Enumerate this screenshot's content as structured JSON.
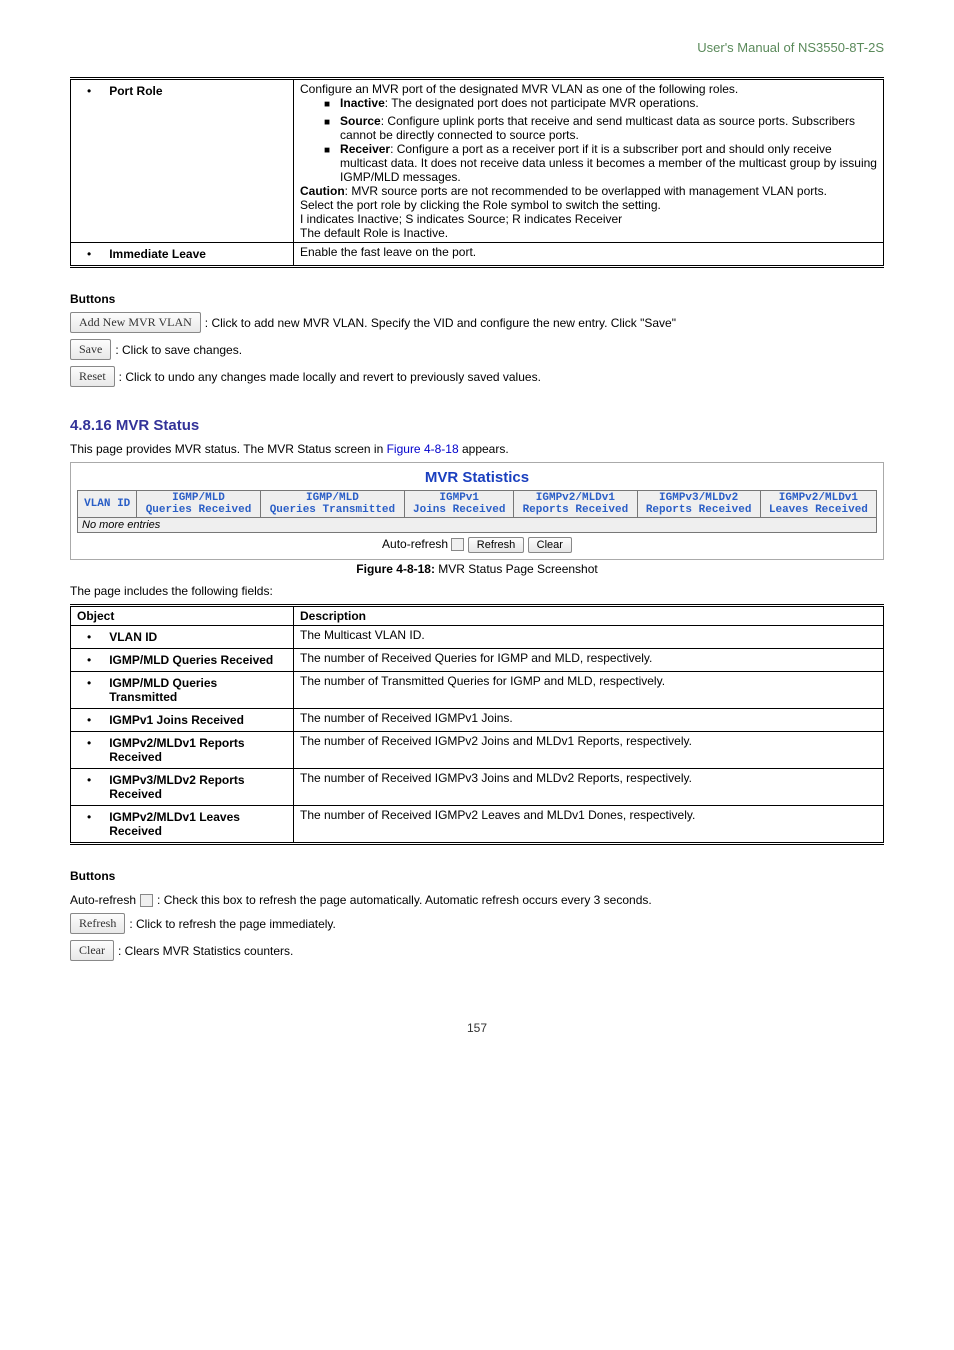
{
  "header": "User's Manual of NS3550-8T-2S",
  "topTable": {
    "rows": [
      {
        "object": "Port Role",
        "intro": "Configure an MVR port of the designated MVR VLAN as one of the following roles.",
        "items": [
          {
            "label": "Inactive",
            "text": ": The designated port does not participate MVR operations."
          },
          {
            "label": "Source",
            "text": ": Configure uplink ports that receive and send multicast data as source ports. Subscribers cannot be directly connected to source ports."
          },
          {
            "label": "Receiver",
            "text": ": Configure a port as a receiver port if it is a subscriber port and should only receive multicast data. It does not receive data unless it becomes a member of the multicast group by issuing IGMP/MLD messages."
          }
        ],
        "caution_label": "Caution",
        "caution": ": MVR source ports are not recommended to be overlapped with management VLAN ports.",
        "tail1": "Select the port role by clicking the Role symbol to switch the setting.",
        "tail2": "I indicates Inactive; S indicates Source; R indicates Receiver",
        "tail3": "The default Role is Inactive."
      },
      {
        "object": "Immediate Leave",
        "intro": "Enable the fast leave on the port."
      }
    ]
  },
  "buttonsTitle": "Buttons",
  "buttons": [
    {
      "label": "Add New MVR VLAN",
      "desc": ": Click to add new MVR VLAN. Specify the VID and configure the new entry. Click \"Save\""
    },
    {
      "label": "Save",
      "desc": ": Click to save changes."
    },
    {
      "label": "Reset",
      "desc": ": Click to undo any changes made locally and revert to previously saved values."
    }
  ],
  "section2": {
    "num": "4.8.16",
    "title": "MVR Status",
    "intro_a": "This page provides MVR status. The MVR Status screen in ",
    "intro_link": "Figure 4-8-18",
    "intro_b": " appears.",
    "screenshot": {
      "title": "MVR Statistics",
      "headers": [
        {
          "l1": "",
          "l2": "VLAN ID"
        },
        {
          "l1": "IGMP/MLD",
          "l2": "Queries Received"
        },
        {
          "l1": "IGMP/MLD",
          "l2": "Queries Transmitted"
        },
        {
          "l1": "IGMPv1",
          "l2": "Joins Received"
        },
        {
          "l1": "IGMPv2/MLDv1",
          "l2": "Reports Received"
        },
        {
          "l1": "IGMPv3/MLDv2",
          "l2": "Reports Received"
        },
        {
          "l1": "IGMPv2/MLDv1",
          "l2": "Leaves Received"
        }
      ],
      "no_entries": "No more entries",
      "auto_refresh": "Auto-refresh",
      "refresh": "Refresh",
      "clear": "Clear"
    },
    "caption_a": "Figure 4-8-18:",
    "caption_b": " MVR Status Page Screenshot",
    "fields_intro": "The page includes the following fields:",
    "fields_header": {
      "object": "Object",
      "desc": "Description"
    },
    "fields": [
      {
        "object": "VLAN ID",
        "desc": "The Multicast VLAN ID."
      },
      {
        "object": "IGMP/MLD Queries Received",
        "desc": "The number of Received Queries for IGMP and MLD, respectively."
      },
      {
        "object": "IGMP/MLD Queries Transmitted",
        "desc": "The number of Transmitted Queries for IGMP and MLD, respectively."
      },
      {
        "object": "IGMPv1 Joins Received",
        "desc": "The number of Received IGMPv1 Joins."
      },
      {
        "object": "IGMPv2/MLDv1 Reports Received",
        "desc": "The number of Received IGMPv2 Joins and MLDv1 Reports, respectively."
      },
      {
        "object": "IGMPv3/MLDv2 Reports Received",
        "desc": "The number of Received IGMPv3 Joins and MLDv2 Reports, respectively."
      },
      {
        "object": "IGMPv2/MLDv1 Leaves Received",
        "desc": "The number of Received IGMPv2 Leaves and MLDv1 Dones, respectively."
      }
    ],
    "buttonsTitle": "Buttons",
    "autorefresh_a": "Auto-refresh ",
    "autorefresh_b": ": Check this box to refresh the page automatically. Automatic refresh occurs every 3 seconds.",
    "buttons2": [
      {
        "label": "Refresh",
        "desc": ": Click to refresh the page immediately."
      },
      {
        "label": "Clear",
        "desc": ": Clears MVR Statistics counters."
      }
    ]
  },
  "pageNum": "157"
}
